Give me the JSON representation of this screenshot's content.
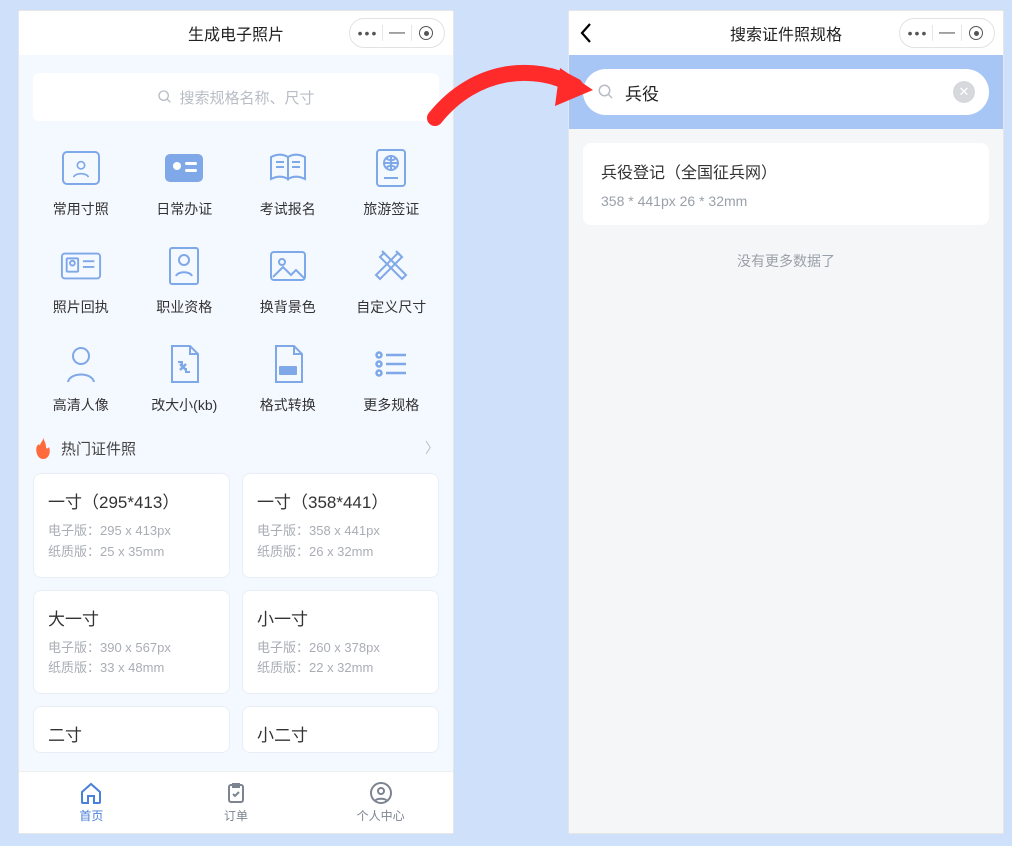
{
  "left": {
    "title": "生成电子照片",
    "search_placeholder": "搜索规格名称、尺寸",
    "categories": [
      {
        "label": "常用寸照"
      },
      {
        "label": "日常办证"
      },
      {
        "label": "考试报名"
      },
      {
        "label": "旅游签证"
      },
      {
        "label": "照片回执"
      },
      {
        "label": "职业资格"
      },
      {
        "label": "换背景色"
      },
      {
        "label": "自定义尺寸"
      },
      {
        "label": "高清人像"
      },
      {
        "label": "改大小(kb)"
      },
      {
        "label": "格式转换"
      },
      {
        "label": "更多规格"
      }
    ],
    "hot_section": "热门证件照",
    "cards": [
      {
        "title": "一寸（295*413）",
        "line1": "电子版：295 x 413px",
        "line2": "纸质版：25 x 35mm"
      },
      {
        "title": "一寸（358*441）",
        "line1": "电子版：358 x 441px",
        "line2": "纸质版：26 x 32mm"
      },
      {
        "title": "大一寸",
        "line1": "电子版：390 x 567px",
        "line2": "纸质版：33 x 48mm"
      },
      {
        "title": "小一寸",
        "line1": "电子版：260 x 378px",
        "line2": "纸质版：22 x 32mm"
      },
      {
        "title": "二寸",
        "line1": "",
        "line2": ""
      },
      {
        "title": "小二寸",
        "line1": "",
        "line2": ""
      }
    ],
    "nav": [
      {
        "label": "首页"
      },
      {
        "label": "订单"
      },
      {
        "label": "个人中心"
      }
    ]
  },
  "right": {
    "title": "搜索证件照规格",
    "search_value": "兵役",
    "result": {
      "title": "兵役登记（全国征兵网）",
      "detail": "358 * 441px   26 * 32mm"
    },
    "nomore": "没有更多数据了"
  }
}
